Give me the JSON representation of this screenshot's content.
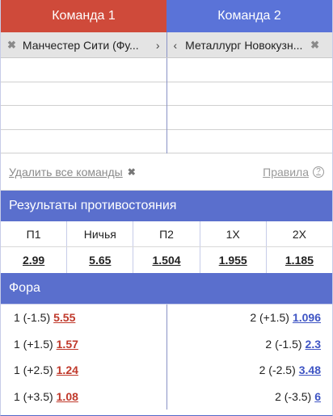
{
  "tabs": {
    "team1": "Команда 1",
    "team2": "Команда 2"
  },
  "teams": {
    "left_name": "Манчестер Сити (Фу...",
    "right_name": "Металлург Новокузн...",
    "remove_icon": "close-icon",
    "left_chevron": "›",
    "right_chevron": "‹",
    "remove_glyph": "✖"
  },
  "actions": {
    "remove_all": "Удалить все команды",
    "remove_glyph": "✖",
    "rules": "Правила",
    "rules_icon": "?"
  },
  "results": {
    "title": "Результаты противостояния",
    "headers": [
      "П1",
      "Ничья",
      "П2",
      "1X",
      "2X"
    ],
    "values": [
      "2.99",
      "5.65",
      "1.504",
      "1.955",
      "1.185"
    ]
  },
  "fora": {
    "title": "Фора",
    "left": [
      {
        "label": "1 (-1.5)",
        "odd": "5.55"
      },
      {
        "label": "1 (+1.5)",
        "odd": "1.57"
      },
      {
        "label": "1 (+2.5)",
        "odd": "1.24"
      },
      {
        "label": "1 (+3.5)",
        "odd": "1.08"
      }
    ],
    "right": [
      {
        "label": "2 (+1.5)",
        "odd": "1.096"
      },
      {
        "label": "2 (-1.5)",
        "odd": "2.3"
      },
      {
        "label": "2 (-2.5)",
        "odd": "3.48"
      },
      {
        "label": "2 (-3.5)",
        "odd": "6"
      }
    ]
  },
  "colors": {
    "team1": "#cf4a3a",
    "team2": "#5a73d8",
    "section": "#5a6fcd"
  }
}
